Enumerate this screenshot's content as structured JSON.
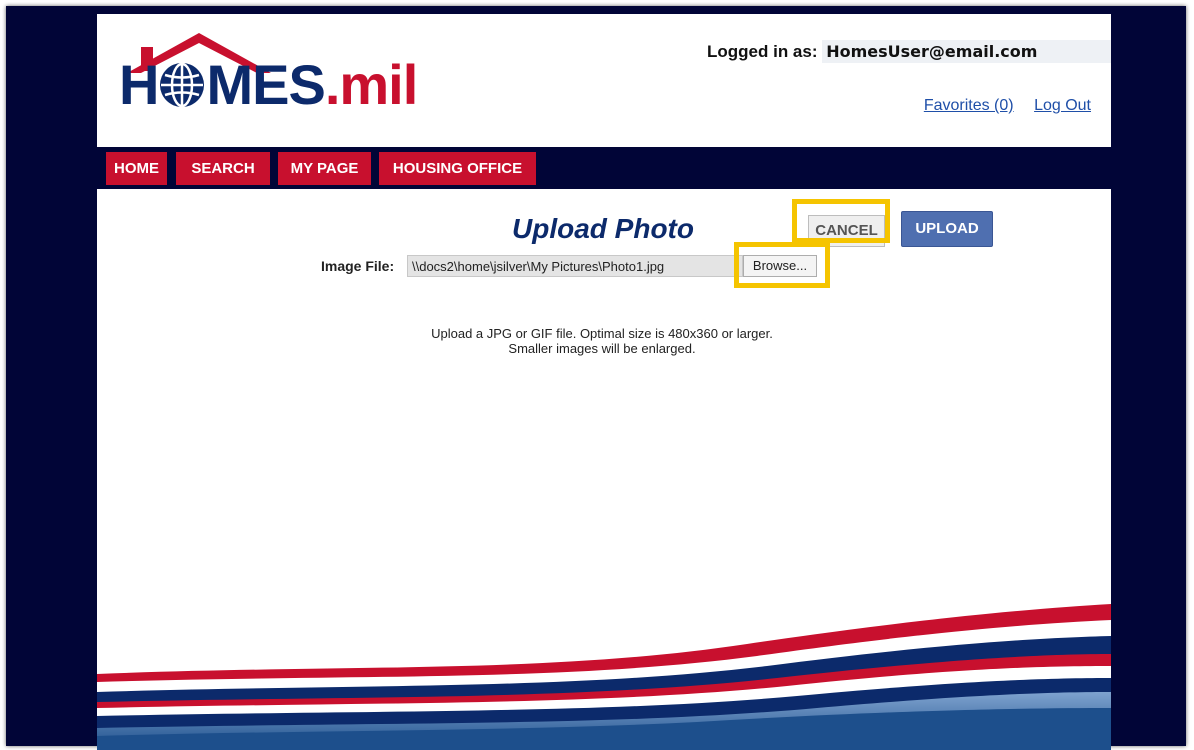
{
  "header": {
    "logo_text": "H●MES.mil",
    "logged_in_label": "Logged in as:",
    "user_email": "HomesUser@email.com",
    "favorites_label": "Favorites (0)",
    "logout_label": "Log Out"
  },
  "nav": {
    "tabs": [
      {
        "label": "HOME"
      },
      {
        "label": "SEARCH"
      },
      {
        "label": "MY PAGE"
      },
      {
        "label": "HOUSING OFFICE"
      }
    ]
  },
  "main": {
    "title": "Upload Photo",
    "cancel_label": "CANCEL",
    "upload_label": "UPLOAD",
    "image_file_label": "Image File:",
    "image_file_value": "\\\\docs2\\home\\jsilver\\My Pictures\\Photo1.jpg",
    "browse_label": "Browse...",
    "hint_line1": "Upload a JPG or GIF file. Optimal size is 480x360 or larger.",
    "hint_line2": "Smaller images will be enlarged."
  },
  "colors": {
    "navy": "#010537",
    "brand_blue": "#0c2a6b",
    "brand_red": "#c8102e",
    "highlight": "#f5c400",
    "upload_button": "#4f6fb0"
  }
}
